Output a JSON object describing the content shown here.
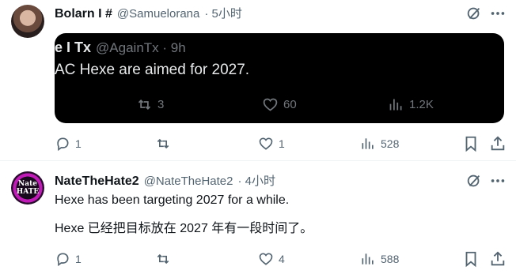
{
  "tweet1": {
    "name": "Bolarn I #",
    "handle": "@Samuelorana",
    "time": "· 5小时",
    "stats": {
      "replies": "1",
      "retweets": "",
      "likes": "1",
      "views": "528"
    }
  },
  "quoted": {
    "name": "e I Tx",
    "handle": "@AgainTx · 9h",
    "text": "AC Hexe are aimed for 2027.",
    "stats": {
      "retweets": "3",
      "likes": "60",
      "views": "1.2K"
    }
  },
  "tweet2": {
    "name": "NateTheHate2",
    "handle": "@NateTheHate2",
    "time": "· 4小时",
    "avatar_text": "Nate\nHATE",
    "text_en": "Hexe has been targeting 2027 for a while.",
    "text_zh": "Hexe 已经把目标放在 2027 年有一段时间了。",
    "stats": {
      "replies": "1",
      "retweets": "",
      "likes": "4",
      "views": "588"
    }
  },
  "colors": {
    "text": "#0f1419",
    "muted": "#536471",
    "quote_bg": "#000000",
    "quote_text": "#e7e9ea"
  },
  "icons": [
    "grok-icon",
    "more-icon",
    "reply-icon",
    "retweet-icon",
    "like-icon",
    "views-icon",
    "bookmark-icon",
    "share-icon"
  ]
}
